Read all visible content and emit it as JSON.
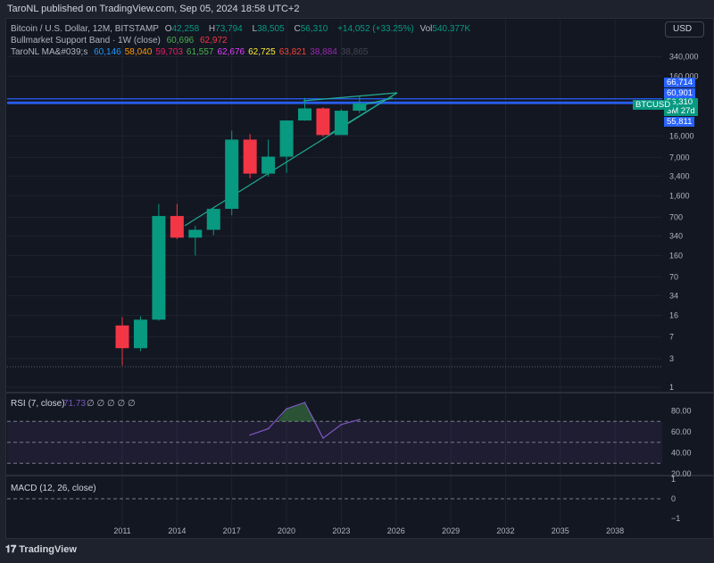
{
  "header": {
    "published": "TaroNL published on TradingView.com, Sep 05, 2024 18:58 UTC+2"
  },
  "legend": {
    "symbol": "Bitcoin / U.S. Dollar, 12M, BITSTAMP",
    "o_label": "O",
    "o": "42,258",
    "h_label": "H",
    "h": "73,794",
    "l_label": "L",
    "l": "38,505",
    "c_label": "C",
    "c": "56,310",
    "change": "+14,052 (+33.25%)",
    "vol_label": "Vol",
    "vol": "540.377K",
    "band_name": "Bullmarket Support Band · 1W (close)",
    "band_values": [
      "60,696",
      "62,972"
    ],
    "ma_name": "TaroNL MA&#039;s",
    "ma_values": [
      {
        "v": "60,146",
        "color": "#2196f3"
      },
      {
        "v": "58,040",
        "color": "#ff9800"
      },
      {
        "v": "59,703",
        "color": "#e91e63"
      },
      {
        "v": "61,557",
        "color": "#4caf50"
      },
      {
        "v": "62,676",
        "color": "#e040fb"
      },
      {
        "v": "62,725",
        "color": "#ffeb3b"
      },
      {
        "v": "63,821",
        "color": "#f44336"
      },
      {
        "v": "38,884",
        "color": "#9c27b0"
      },
      {
        "v": "38,865",
        "color": "#434651"
      }
    ]
  },
  "currency_button": "USD",
  "price_tags": {
    "symbol": "BTCUSD",
    "p1": "66,714",
    "p2": "60,901",
    "last": "56,310",
    "countdown": "3M 27d",
    "p4": "55,811"
  },
  "footer": {
    "brand": "TradingView"
  },
  "chart_data": [
    {
      "type": "candlestick",
      "scale": "log",
      "grid": true,
      "yticks": [
        "340,000",
        "160,000",
        "16,000",
        "7,000",
        "3,400",
        "1,600",
        "700",
        "340",
        "160",
        "70",
        "34",
        "16",
        "7",
        "3",
        "1"
      ],
      "xticks": [
        "2011",
        "2014",
        "2017",
        "2020",
        "2023",
        "2026",
        "2029",
        "2032",
        "2035",
        "2038"
      ],
      "candles": [
        {
          "year": 2011,
          "o": 10.8,
          "h": 15,
          "l": 2.3,
          "c": 4.5
        },
        {
          "year": 2012,
          "o": 4.5,
          "h": 15.4,
          "l": 4,
          "c": 13.5
        },
        {
          "year": 2013,
          "o": 13.5,
          "h": 1163,
          "l": 13,
          "c": 732
        },
        {
          "year": 2014,
          "o": 732,
          "h": 1165,
          "l": 300,
          "c": 318
        },
        {
          "year": 2015,
          "o": 318,
          "h": 502,
          "l": 160,
          "c": 430
        },
        {
          "year": 2016,
          "o": 430,
          "h": 981,
          "l": 350,
          "c": 964
        },
        {
          "year": 2017,
          "o": 964,
          "h": 19666,
          "l": 752,
          "c": 13880
        },
        {
          "year": 2018,
          "o": 13880,
          "h": 17234,
          "l": 3122,
          "c": 3742
        },
        {
          "year": 2019,
          "o": 3742,
          "h": 13880,
          "l": 3350,
          "c": 7194
        },
        {
          "year": 2020,
          "o": 7194,
          "h": 29300,
          "l": 3850,
          "c": 28990
        },
        {
          "year": 2021,
          "o": 28990,
          "h": 69000,
          "l": 28800,
          "c": 46200
        },
        {
          "year": 2022,
          "o": 46200,
          "h": 48200,
          "l": 15460,
          "c": 16550
        },
        {
          "year": 2023,
          "o": 16550,
          "h": 44700,
          "l": 16490,
          "c": 42258
        },
        {
          "year": 2024,
          "o": 42258,
          "h": 73794,
          "l": 38505,
          "c": 56310
        }
      ],
      "levels": [
        66714,
        60901,
        56310,
        55811
      ],
      "colors": {
        "up": "#089981",
        "down": "#f23645",
        "level": "#2962ff"
      }
    },
    {
      "type": "line",
      "title": "RSI (7, close)",
      "last": "71.73",
      "extra": "∅ ∅ ∅ ∅ ∅",
      "yticks": [
        "80.00",
        "60.00",
        "40.00",
        "20.00"
      ],
      "bands": [
        30,
        50,
        70
      ],
      "x": [
        2018,
        2019,
        2020,
        2021,
        2022,
        2023,
        2024
      ],
      "values": [
        57,
        63,
        82,
        88,
        54,
        67,
        71.73
      ],
      "color": "#7e57c2"
    },
    {
      "type": "line",
      "title": "MACD (12, 26, close)",
      "yticks": [
        "1",
        "0",
        "−1"
      ],
      "values": []
    }
  ]
}
